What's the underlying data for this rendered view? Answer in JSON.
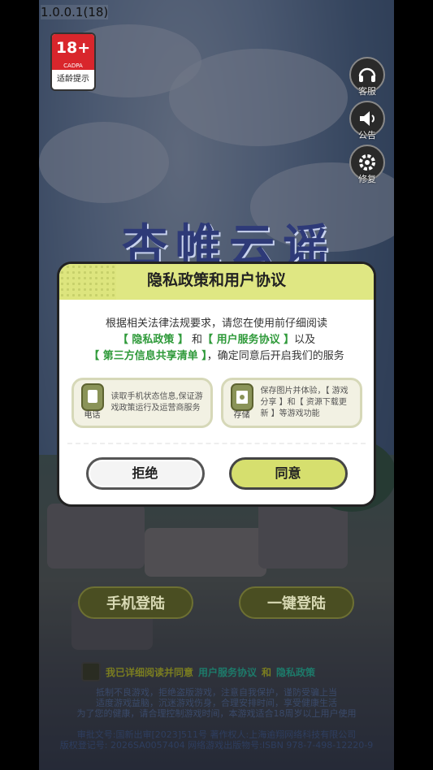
{
  "version": "1.0.0.1(18)",
  "age_badge": {
    "rating": "18+",
    "org": "CADPA",
    "label": "适龄提示"
  },
  "side_buttons": [
    {
      "label": "客服",
      "icon": "headset-icon"
    },
    {
      "label": "公告",
      "icon": "speaker-icon"
    },
    {
      "label": "修复",
      "icon": "gear-icon"
    }
  ],
  "game_title": "杏帷云谣",
  "modal": {
    "title": "隐私政策和用户协议",
    "line1": "根据相关法律法规要求，请您在使用前仔细阅读",
    "privacy_policy": "【 隐私政策 】",
    "and": " 和",
    "user_agreement": "【 用户服务协议 】",
    "and2": "以及",
    "third_party": "【 第三方信息共享清单 】",
    "line3_tail": "，确定同意后开启我们的服务",
    "permissions": [
      {
        "icon_label": "电话",
        "text": "读取手机状态信息,保证游戏政策运行及运营商服务"
      },
      {
        "icon_label": "存储",
        "text": "保存图片并体验，【 游戏分享 】和【 资源下载更新 】等游戏功能"
      }
    ],
    "reject_label": "拒绝",
    "agree_label": "同意"
  },
  "login": {
    "phone_label": "手机登陆",
    "one_key_label": "一键登陆"
  },
  "agreement": {
    "prefix": "我已详细阅读并同意",
    "user_agreement": "用户服务协议",
    "and": "和",
    "privacy": "隐私政策"
  },
  "health_notice": [
    "抵制不良游戏，拒绝盗版游戏，注意自我保护，谨防受骗上当",
    "适度游戏益脑，沉迷游戏伤身，合理安排时间，享受健康生活",
    "为了您的健康，请合理控制游戏时间，本游戏适合18周岁以上用户使用"
  ],
  "legal": [
    "审批文号:国新出审[2023]511号  著作权人:上海逾翔网络科技有限公司",
    "版权登记号: 2026SA0057404  网络游戏出版物号:ISBN 978-7-498-12220-9"
  ]
}
